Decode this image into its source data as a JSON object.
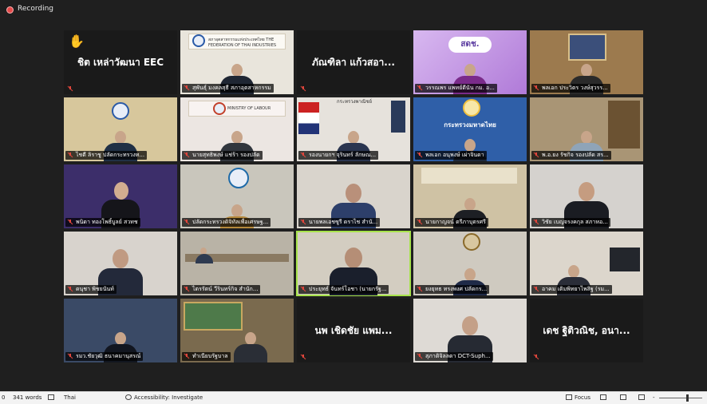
{
  "recording": {
    "label": "Recording"
  },
  "tiles": [
    {
      "name": "",
      "big_name": "ชิต เหล่าวัฒนา EEC",
      "hand": "✋"
    },
    {
      "name": "สุพันธุ์ มงคลสุธี สภาอุตสาหกรรม",
      "big_name": "",
      "sign": "สภาอุตสาหกรรมแห่งประเทศไทย THE FEDERATION OF THAI INDUSTRIES"
    },
    {
      "name": "",
      "big_name": "ภัณฑิลา แก้วสอา..."
    },
    {
      "name": "วรรณพร แพทย์ดีนัน กม. อ...",
      "big_name": "",
      "sign": "สดช."
    },
    {
      "name": "พลเอก ประวิตร วงษ์สุวรร...",
      "big_name": ""
    },
    {
      "name": "ไชตี ลิราชู ปลัดกระทรวงท...",
      "big_name": ""
    },
    {
      "name": "นายสุทธิพงษ์ แช่ร้า รองปลัด",
      "big_name": "",
      "sign": "MINISTRY OF LABOUR"
    },
    {
      "name": "รองนายกฯ จุรินทร์ ลักษณ...",
      "big_name": "",
      "sign": "กระทรวงพาณิชย์"
    },
    {
      "name": "พลเอก อนุพงษ์ เผ่าจินดา",
      "big_name": "",
      "sign": "กระทรวงมหาดไทย"
    },
    {
      "name": "พ.อ.ยง รัชกิจ รองปลัด สร...",
      "big_name": ""
    },
    {
      "name": "พนิดา ทองโพธิ์บูลย์ สวทช",
      "big_name": ""
    },
    {
      "name": "ปลัดกระทรวงดิจิทัลเพื่อเศรษฐ...",
      "big_name": ""
    },
    {
      "name": "นายพลเอชซูรี ดราไช สำนั...",
      "big_name": ""
    },
    {
      "name": "นายกาญจน์ ตรีภาบุตรศรี",
      "big_name": ""
    },
    {
      "name": "วิชัย เบญจรงคกุล สภาหอ...",
      "big_name": ""
    },
    {
      "name": "ดนุชา พิชยนันท์",
      "big_name": ""
    },
    {
      "name": "ไตรรัตน์ วีรินทร์กิจ สำนัก...",
      "big_name": ""
    },
    {
      "name": "ประยุทธ์ จันทร์โอชา (นายกรัฐ...",
      "big_name": ""
    },
    {
      "name": "ยงยุทธ ทรงพงศ ปลัดกร...",
      "big_name": ""
    },
    {
      "name": "อาคม เติมพิทยาไพสิฐ (รม...",
      "big_name": ""
    },
    {
      "name": "รมว.ชัยวุฒิ ธนาคมานุสรณ์",
      "big_name": ""
    },
    {
      "name": "ทำเนียบรัฐบาล",
      "big_name": ""
    },
    {
      "name": "",
      "big_name": "นพ เชิดชัย แพม..."
    },
    {
      "name": "สุภาติจิลลดา DCT-Suph...",
      "big_name": ""
    },
    {
      "name": "",
      "big_name": "เดช ฐิติวณิช, อนา..."
    }
  ],
  "statusbar": {
    "page_indicator": "0",
    "words": "341 words",
    "language": "Thai",
    "accessibility": "Accessibility: Investigate",
    "focus": "Focus"
  },
  "colors": {
    "background": "#1f1f1f",
    "tile": "#2d2d2d",
    "active_speaker": "#a7e34b",
    "recording": "#e54b4b",
    "mic_muted": "#e0463c"
  }
}
